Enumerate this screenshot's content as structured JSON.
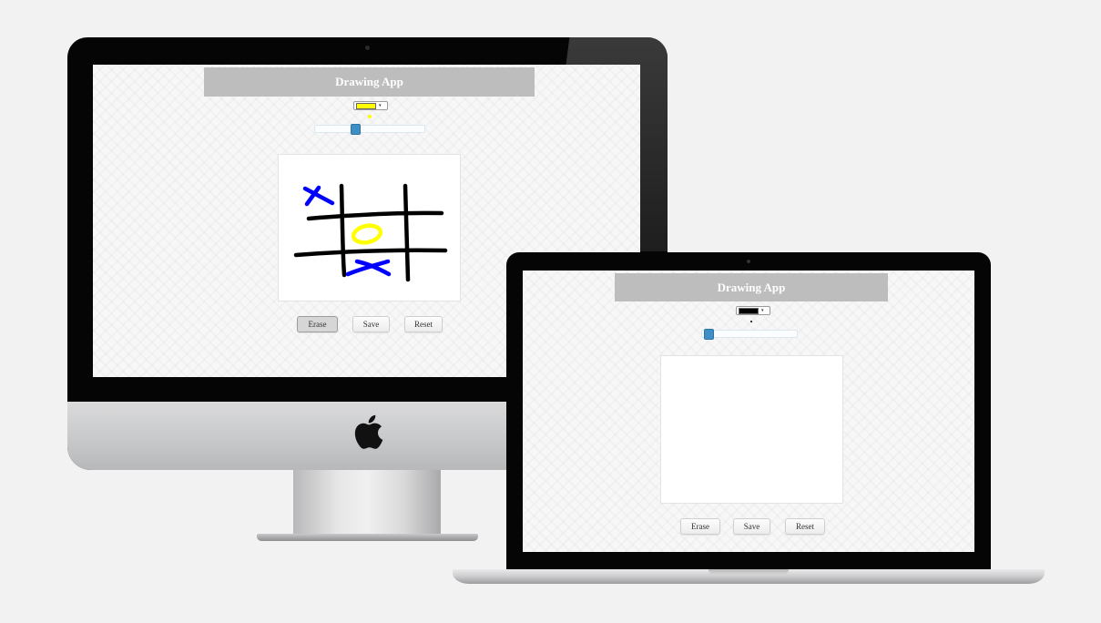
{
  "desktop_app": {
    "title": "Drawing App",
    "selected_color": "#ffff00",
    "brush_size_fraction": 0.35,
    "buttons": {
      "erase": "Erase",
      "save": "Save",
      "reset": "Reset"
    },
    "active_button": "erase"
  },
  "laptop_app": {
    "title": "Drawing App",
    "selected_color": "#000000",
    "brush_size_fraction": 0.02,
    "buttons": {
      "erase": "Erase",
      "save": "Save",
      "reset": "Reset"
    }
  },
  "colors": {
    "header_bg": "#bdbdbd",
    "slider_handle": "#3f8fc4",
    "stroke_black": "#000000",
    "stroke_blue": "#0000ff",
    "stroke_yellow": "#ffff00"
  },
  "icons": [
    "apple-logo-icon",
    "chevron-down-icon",
    "webcam-icon"
  ]
}
